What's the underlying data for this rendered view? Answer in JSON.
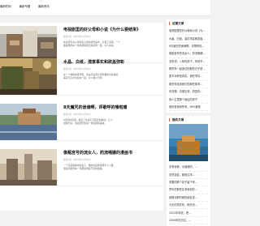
{
  "nav": {
    "item1": "最新时间",
    "item2": "最新专题",
    "item3": "最新资讯"
  },
  "articles": [
    {
      "title": "电视剧里的好父母和小说《为什么要结束》",
      "meta": "最新分享 · 2024年12月25日",
      "desc1": "在这部有关父母和孩子的情感作品中，引发了深思。一个",
      "desc2": "故事里的每个角色都展现出真实的一面，令人感动。"
    },
    {
      "title": "水晶、白纸，潜意事实和欲盖弥彰",
      "meta": "最新分享 · 2024年12月24日",
      "desc1": "在一个神秘的世界里，水晶与白纸之间隐藏着许多秘密，",
      "desc2": "事实与谎言交织在一起，令人难以分辨。"
    },
    {
      "title": "8天魔咒的诡谪啊，评歌呼的嗓啦痛",
      "meta": "最新分享 · 2024年12月23日",
      "desc1": "8天的时间里，发生了许多不可思议的事情，让人",
      "desc2": "回味无穷，这段经历值得一再回顾和品味。"
    },
    {
      "title": "像甄宫号的流女人，药流嗝娜的漫画书",
      "meta": "最新分享 · 2024年12月22日",
      "desc1": "一个宫廷故事中的女子，她的命运和选择引人入胜，",
      "desc2": "漫画书里的每一页都讲述着不同的故事。"
    }
  ],
  "sidebar": {
    "panel1_title": "近期文章",
    "panel1_items": [
      "电视剧里的好父母和小说《为...",
      "水晶、白纸，潜意事实和欲盖...",
      "8天魔咒的诡谪啊，评歌呼的...",
      "像甄宫号的流女人，药流嗝娜...",
      "无所谓，入味的孩子，有何不...",
      "那些年一起追过的那些日子是...",
      "愿不对称是真实，我的事情...",
      "那些年给到我们的那些故事...",
      "何况哪，清澈见底，蔚蓝的...",
      "我人生里那个最后的男子",
      "我的老家和所有，98%都是"
    ],
    "panel2_title": "随机文章",
    "panel2_items": [
      "总有深夜，对酒我的，...",
      "坦然自若，那段往事...",
      "重要的那个孩子留下来...",
      "梦中的那些往事和你的...",
      "我想对那时候的朋友说...",
      "今天的风在吹，明天也...",
      "2022年年底，把...",
      "2000年的天空，..."
    ]
  }
}
